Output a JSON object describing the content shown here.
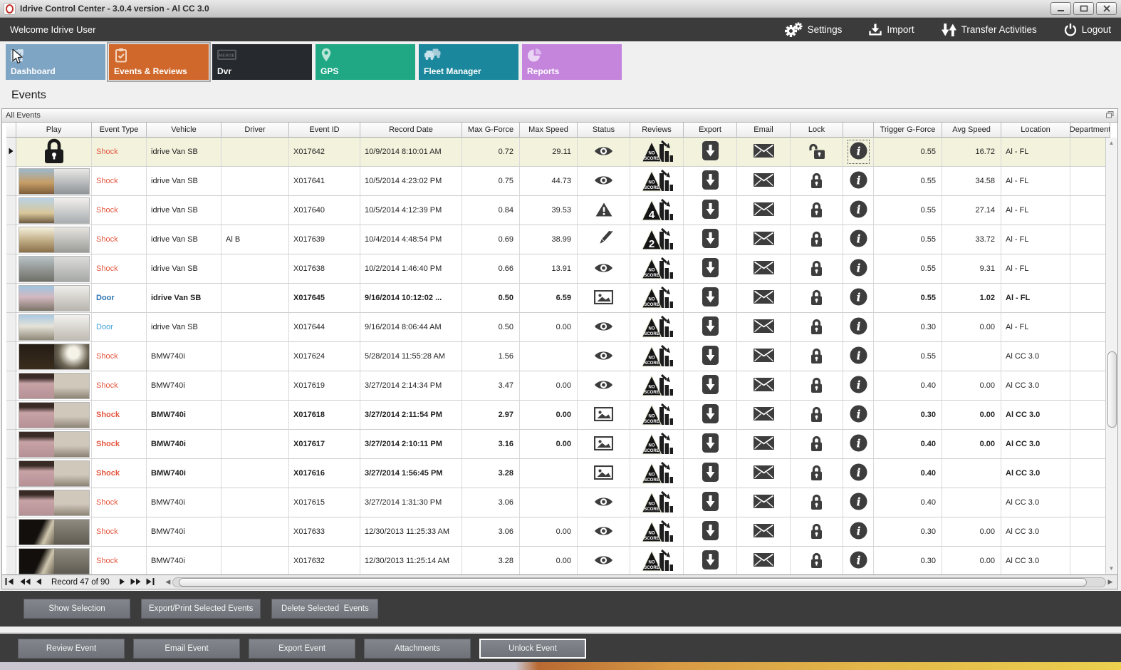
{
  "window": {
    "title": "Idrive Control Center - 3.0.4 version - Al CC 3.0"
  },
  "topbar": {
    "welcome": "Welcome Idrive User",
    "actions": [
      {
        "label": "Settings",
        "icon": "settings-gears"
      },
      {
        "label": "Import",
        "icon": "import-download"
      },
      {
        "label": "Transfer Activities",
        "icon": "transfer-arrows"
      },
      {
        "label": "Logout",
        "icon": "power"
      }
    ]
  },
  "tabs": [
    {
      "label": "Dashboard",
      "color": "#7fa5c5",
      "icon": "dashboard-chart",
      "active": false,
      "cursor": true
    },
    {
      "label": "Events & Reviews",
      "color": "#d0682c",
      "icon": "clipboard-check",
      "active": true,
      "cursor": false
    },
    {
      "label": "Dvr",
      "color": "#26292e",
      "icon": "dvr-box",
      "active": false,
      "cursor": false
    },
    {
      "label": "GPS",
      "color": "#20a885",
      "icon": "map-pin",
      "active": false,
      "cursor": false
    },
    {
      "label": "Fleet Manager",
      "color": "#1b879d",
      "icon": "vehicles",
      "active": false,
      "cursor": false
    },
    {
      "label": "Reports",
      "color": "#c585dd",
      "icon": "pie-chart",
      "active": false,
      "cursor": false
    }
  ],
  "page_title": "Events",
  "panel_title": "All Events",
  "table": {
    "columns": [
      "Play",
      "Event Type",
      "Vehicle",
      "Driver",
      "Event ID",
      "Record Date",
      "Max G-Force",
      "Max Speed",
      "Status",
      "Reviews",
      "Export",
      "Email",
      "Lock",
      "",
      "Trigger G-Force",
      "Avg Speed",
      "Location",
      "Department"
    ],
    "rows": [
      {
        "play": "lock",
        "thumb": "",
        "event_type": "Shock",
        "vehicle": "idrive Van SB",
        "driver": "",
        "event_id": "X017642",
        "record_date": "10/9/2014 8:10:01 AM",
        "max_g": "0.72",
        "max_speed": "29.11",
        "status": "eye",
        "review": "NO SCORE",
        "lock": "unlocked",
        "trigger_g": "0.55",
        "avg_speed": "16.72",
        "location": "Al - FL",
        "department": "",
        "bold": false,
        "selected": true,
        "info_focused": true
      },
      {
        "play": "thumb",
        "thumb": "road-crane",
        "event_type": "Shock",
        "vehicle": "idrive Van SB",
        "driver": "",
        "event_id": "X017641",
        "record_date": "10/5/2014 4:23:02 PM",
        "max_g": "0.75",
        "max_speed": "44.73",
        "status": "eye",
        "review": "NO SCORE",
        "lock": "locked",
        "trigger_g": "0.55",
        "avg_speed": "34.58",
        "location": "Al - FL",
        "department": "",
        "bold": false,
        "selected": false,
        "info_focused": false
      },
      {
        "play": "thumb",
        "thumb": "road-day",
        "event_type": "Shock",
        "vehicle": "idrive Van SB",
        "driver": "",
        "event_id": "X017640",
        "record_date": "10/5/2014 4:12:39 PM",
        "max_g": "0.84",
        "max_speed": "39.53",
        "status": "warning",
        "review": "4",
        "lock": "locked",
        "trigger_g": "0.55",
        "avg_speed": "27.14",
        "location": "Al - FL",
        "department": "",
        "bold": false,
        "selected": false,
        "info_focused": false
      },
      {
        "play": "thumb",
        "thumb": "road-bright",
        "event_type": "Shock",
        "vehicle": "idrive Van SB",
        "driver": "Al B",
        "event_id": "X017639",
        "record_date": "10/4/2014 4:48:54 PM",
        "max_g": "0.69",
        "max_speed": "38.99",
        "status": "pencil",
        "review": "2",
        "lock": "locked",
        "trigger_g": "0.55",
        "avg_speed": "33.72",
        "location": "Al - FL",
        "department": "",
        "bold": false,
        "selected": false,
        "info_focused": false
      },
      {
        "play": "thumb",
        "thumb": "road-overcast",
        "event_type": "Shock",
        "vehicle": "idrive Van SB",
        "driver": "",
        "event_id": "X017638",
        "record_date": "10/2/2014 1:46:40 PM",
        "max_g": "0.66",
        "max_speed": "13.91",
        "status": "eye",
        "review": "NO SCORE",
        "lock": "locked",
        "trigger_g": "0.55",
        "avg_speed": "9.31",
        "location": "Al - FL",
        "department": "",
        "bold": false,
        "selected": false,
        "info_focused": false
      },
      {
        "play": "thumb",
        "thumb": "road-tree",
        "event_type": "Door",
        "vehicle": "idrive Van SB",
        "driver": "",
        "event_id": "X017645",
        "record_date": "9/16/2014 10:12:02 ...",
        "max_g": "0.50",
        "max_speed": "6.59",
        "status": "image",
        "review": "NO SCORE",
        "lock": "locked",
        "trigger_g": "0.55",
        "avg_speed": "1.02",
        "location": "Al - FL",
        "department": "",
        "bold": true,
        "selected": false,
        "info_focused": false
      },
      {
        "play": "thumb",
        "thumb": "road-tree2",
        "event_type": "Door",
        "vehicle": "idrive Van SB",
        "driver": "",
        "event_id": "X017644",
        "record_date": "9/16/2014 8:06:44 AM",
        "max_g": "0.50",
        "max_speed": "0.00",
        "status": "eye",
        "review": "NO SCORE",
        "lock": "locked",
        "trigger_g": "0.30",
        "avg_speed": "0.00",
        "location": "Al - FL",
        "department": "",
        "bold": false,
        "selected": false,
        "info_focused": false
      },
      {
        "play": "thumb",
        "thumb": "cabin-flash",
        "event_type": "Shock",
        "vehicle": "BMW740i",
        "driver": "",
        "event_id": "X017624",
        "record_date": "5/28/2014 11:55:28 AM",
        "max_g": "1.56",
        "max_speed": "",
        "status": "eye",
        "review": "NO SCORE",
        "lock": "locked",
        "trigger_g": "0.55",
        "avg_speed": "",
        "location": "Al CC 3.0",
        "department": "",
        "bold": false,
        "selected": false,
        "info_focused": false
      },
      {
        "play": "thumb",
        "thumb": "cabin-pink",
        "event_type": "Shock",
        "vehicle": "BMW740i",
        "driver": "",
        "event_id": "X017619",
        "record_date": "3/27/2014 2:14:34 PM",
        "max_g": "3.47",
        "max_speed": "0.00",
        "status": "eye",
        "review": "NO SCORE",
        "lock": "locked",
        "trigger_g": "0.40",
        "avg_speed": "0.00",
        "location": "Al CC 3.0",
        "department": "",
        "bold": false,
        "selected": false,
        "info_focused": false
      },
      {
        "play": "thumb",
        "thumb": "cabin-pink",
        "event_type": "Shock",
        "vehicle": "BMW740i",
        "driver": "",
        "event_id": "X017618",
        "record_date": "3/27/2014 2:11:54 PM",
        "max_g": "2.97",
        "max_speed": "0.00",
        "status": "image",
        "review": "NO SCORE",
        "lock": "locked",
        "trigger_g": "0.30",
        "avg_speed": "0.00",
        "location": "Al CC 3.0",
        "department": "",
        "bold": true,
        "selected": false,
        "info_focused": false
      },
      {
        "play": "thumb",
        "thumb": "cabin-pink",
        "event_type": "Shock",
        "vehicle": "BMW740i",
        "driver": "",
        "event_id": "X017617",
        "record_date": "3/27/2014 2:10:11 PM",
        "max_g": "3.16",
        "max_speed": "0.00",
        "status": "image",
        "review": "NO SCORE",
        "lock": "locked",
        "trigger_g": "0.40",
        "avg_speed": "0.00",
        "location": "Al CC 3.0",
        "department": "",
        "bold": true,
        "selected": false,
        "info_focused": false
      },
      {
        "play": "thumb",
        "thumb": "cabin-pink",
        "event_type": "Shock",
        "vehicle": "BMW740i",
        "driver": "",
        "event_id": "X017616",
        "record_date": "3/27/2014 1:56:45 PM",
        "max_g": "3.28",
        "max_speed": "",
        "status": "image",
        "review": "NO SCORE",
        "lock": "locked",
        "trigger_g": "0.40",
        "avg_speed": "",
        "location": "Al CC 3.0",
        "department": "",
        "bold": true,
        "selected": false,
        "info_focused": false
      },
      {
        "play": "thumb",
        "thumb": "cabin-pink",
        "event_type": "Shock",
        "vehicle": "BMW740i",
        "driver": "",
        "event_id": "X017615",
        "record_date": "3/27/2014 1:31:30 PM",
        "max_g": "3.06",
        "max_speed": "",
        "status": "eye",
        "review": "NO SCORE",
        "lock": "locked",
        "trigger_g": "0.40",
        "avg_speed": "",
        "location": "Al CC 3.0",
        "department": "",
        "bold": false,
        "selected": false,
        "info_focused": false
      },
      {
        "play": "thumb",
        "thumb": "cabin-dark",
        "event_type": "Shock",
        "vehicle": "BMW740i",
        "driver": "",
        "event_id": "X017633",
        "record_date": "12/30/2013 11:25:33 AM",
        "max_g": "3.06",
        "max_speed": "0.00",
        "status": "eye",
        "review": "NO SCORE",
        "lock": "locked",
        "trigger_g": "0.30",
        "avg_speed": "0.00",
        "location": "Al CC 3.0",
        "department": "",
        "bold": false,
        "selected": false,
        "info_focused": false
      },
      {
        "play": "thumb",
        "thumb": "cabin-dark",
        "event_type": "Shock",
        "vehicle": "BMW740i",
        "driver": "",
        "event_id": "X017632",
        "record_date": "12/30/2013 11:25:14 AM",
        "max_g": "3.28",
        "max_speed": "0.00",
        "status": "eye",
        "review": "NO SCORE",
        "lock": "locked",
        "trigger_g": "0.30",
        "avg_speed": "0.00",
        "location": "Al CC 3.0",
        "department": "",
        "bold": false,
        "selected": false,
        "info_focused": false
      }
    ]
  },
  "pager": {
    "record_text": "Record 47 of 90"
  },
  "selection_buttons": [
    "Show Selection",
    "Export/Print Selected Events",
    "Delete Selected  Events"
  ],
  "event_buttons": [
    "Review Event",
    "Email Event",
    "Export Event",
    "Attachments",
    "Unlock Event"
  ],
  "focused_event_button": "Unlock Event",
  "colors": {
    "accent_orange": "#d0682c",
    "shock_text": "#e4573f",
    "door_text": "#41a0da",
    "selected_row": "#f2f2dd",
    "dark_bar": "#3c3c3c"
  }
}
